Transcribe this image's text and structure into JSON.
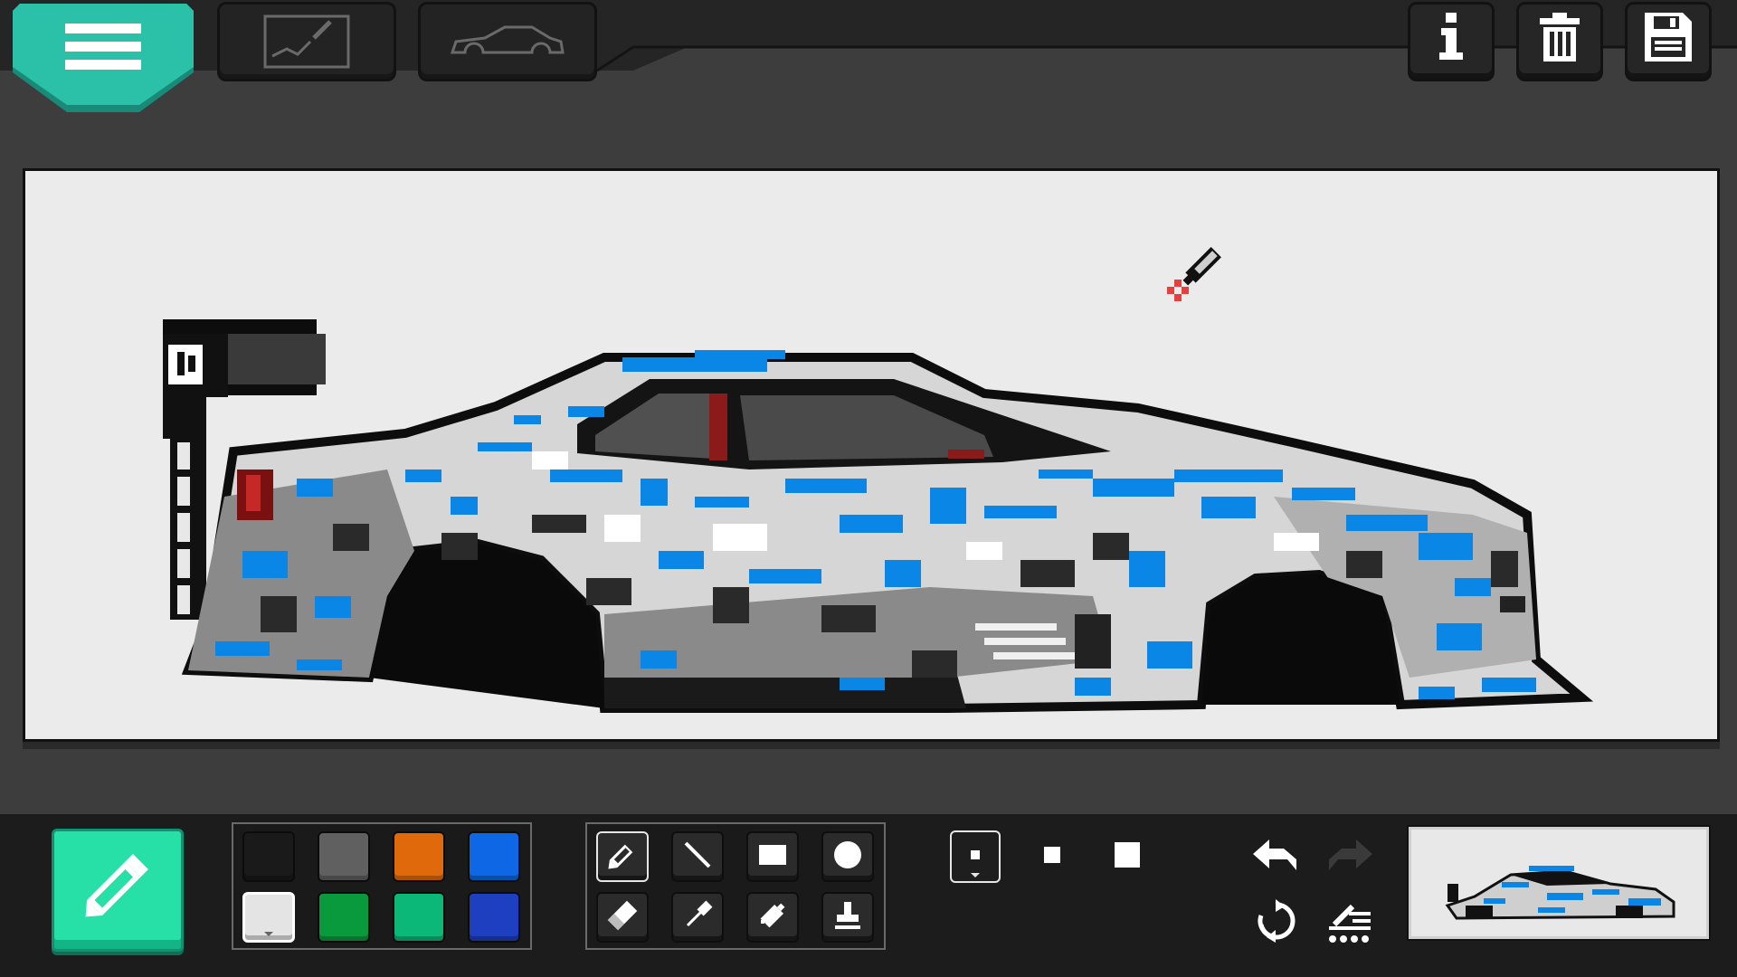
{
  "topbar": {
    "menu": {
      "icon": "hamburger-icon",
      "color": "#2bc0a8"
    },
    "tabs": [
      {
        "name": "draw-tab",
        "icon": "drawing-board-icon"
      },
      {
        "name": "car-tab",
        "icon": "car-silhouette-icon"
      }
    ],
    "actions": [
      {
        "name": "info-button",
        "icon": "info-icon"
      },
      {
        "name": "delete-button",
        "icon": "trash-icon"
      },
      {
        "name": "save-button",
        "icon": "floppy-disk-icon"
      }
    ]
  },
  "canvas": {
    "background": "#ebebeb",
    "subject": "car-livery-icon",
    "cursor": "pen-cursor-icon"
  },
  "toolbar": {
    "active_tool": "pencil",
    "palette": [
      {
        "color": "#1a1a1a",
        "selected": false
      },
      {
        "color": "#606060",
        "selected": false
      },
      {
        "color": "#e06a0b",
        "selected": false
      },
      {
        "color": "#0e68e6",
        "selected": false
      },
      {
        "color": "#e4e4e4",
        "selected": true
      },
      {
        "color": "#0a9a3e",
        "selected": false
      },
      {
        "color": "#0bb878",
        "selected": false
      },
      {
        "color": "#1d3fc0",
        "selected": false
      }
    ],
    "tools": [
      {
        "name": "pencil",
        "icon": "pencil-icon",
        "selected": true
      },
      {
        "name": "line",
        "icon": "line-icon",
        "selected": false
      },
      {
        "name": "rectangle",
        "icon": "rectangle-icon",
        "selected": false
      },
      {
        "name": "circle",
        "icon": "circle-icon",
        "selected": false
      },
      {
        "name": "eraser",
        "icon": "eraser-icon",
        "selected": false
      },
      {
        "name": "eyedropper",
        "icon": "eyedropper-icon",
        "selected": false
      },
      {
        "name": "spray",
        "icon": "spray-can-icon",
        "selected": false
      },
      {
        "name": "stamp",
        "icon": "stamp-icon",
        "selected": false
      }
    ],
    "brush_sizes": [
      {
        "name": "small",
        "selected": true
      },
      {
        "name": "medium",
        "selected": false
      },
      {
        "name": "large",
        "selected": false
      }
    ],
    "history": [
      {
        "name": "undo",
        "icon": "undo-icon",
        "enabled": true
      },
      {
        "name": "redo",
        "icon": "redo-icon",
        "enabled": false
      },
      {
        "name": "flip",
        "icon": "rotate-icon",
        "enabled": true
      },
      {
        "name": "layers",
        "icon": "layers-edit-icon",
        "enabled": true
      }
    ],
    "preview": {
      "icon": "livery-preview-icon"
    }
  }
}
